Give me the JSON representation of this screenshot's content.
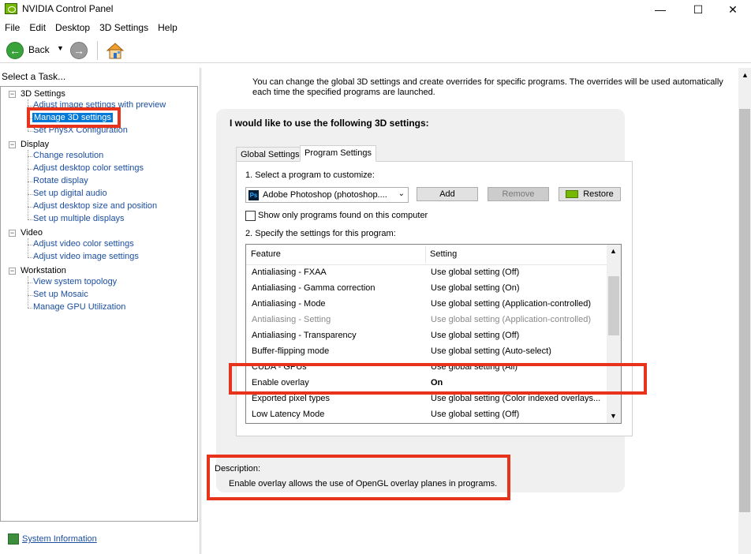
{
  "window": {
    "title": "NVIDIA Control Panel",
    "controls": {
      "minimize": "—",
      "maximize": "☐",
      "close": "✕"
    }
  },
  "menu": [
    "File",
    "Edit",
    "Desktop",
    "3D Settings",
    "Help"
  ],
  "toolbar": {
    "back_label": "Back",
    "back_dropdown": "▼",
    "back_arrow": "←",
    "forward_arrow": "→"
  },
  "sidebar": {
    "header": "Select a Task...",
    "groups": [
      {
        "label": "3D Settings",
        "toggle": "−",
        "items": [
          "Adjust image settings with preview",
          "Manage 3D settings",
          "Set PhysX Configuration"
        ]
      },
      {
        "label": "Display",
        "toggle": "−",
        "items": [
          "Change resolution",
          "Adjust desktop color settings",
          "Rotate display",
          "Set up digital audio",
          "Adjust desktop size and position",
          "Set up multiple displays"
        ]
      },
      {
        "label": "Video",
        "toggle": "−",
        "items": [
          "Adjust video color settings",
          "Adjust video image settings"
        ]
      },
      {
        "label": "Workstation",
        "toggle": "−",
        "items": [
          "View system topology",
          "Set up Mosaic",
          "Manage GPU Utilization"
        ]
      }
    ],
    "selected_item": "Manage 3D settings",
    "system_info": "System Information"
  },
  "content": {
    "intro": "You can change the global 3D settings and create overrides for specific programs. The overrides will be used automatically each time the specified programs are launched.",
    "heading": "I would like to use the following 3D settings:",
    "tabs": [
      {
        "label": "Global Settings",
        "active": false
      },
      {
        "label": "Program Settings",
        "active": true
      }
    ],
    "step1": "1. Select a program to customize:",
    "program_select": {
      "value": "Adobe Photoshop (photoshop....",
      "icon": "Ps",
      "chevron": "⌄"
    },
    "buttons": {
      "add": "Add",
      "remove": "Remove",
      "restore": "Restore"
    },
    "show_only_label": "Show only programs found on this computer",
    "step2": "2. Specify the settings for this program:",
    "table": {
      "columns": [
        "Feature",
        "Setting"
      ],
      "rows": [
        {
          "feature": "Antialiasing - FXAA",
          "setting": "Use global setting (Off)",
          "state": "normal"
        },
        {
          "feature": "Antialiasing - Gamma correction",
          "setting": "Use global setting (On)",
          "state": "normal"
        },
        {
          "feature": "Antialiasing - Mode",
          "setting": "Use global setting (Application-controlled)",
          "state": "normal"
        },
        {
          "feature": "Antialiasing - Setting",
          "setting": "Use global setting (Application-controlled)",
          "state": "disabled"
        },
        {
          "feature": "Antialiasing - Transparency",
          "setting": "Use global setting (Off)",
          "state": "normal"
        },
        {
          "feature": "Buffer-flipping mode",
          "setting": "Use global setting (Auto-select)",
          "state": "normal"
        },
        {
          "feature": "CUDA - GPUs",
          "setting": "Use global setting (All)",
          "state": "normal"
        },
        {
          "feature": "Enable overlay",
          "setting": "On",
          "state": "bold"
        },
        {
          "feature": "Exported pixel types",
          "setting": "Use global setting (Color indexed overlays...",
          "state": "normal"
        },
        {
          "feature": "Low Latency Mode",
          "setting": "Use global setting (Off)",
          "state": "normal"
        }
      ],
      "scroll_up": "▲",
      "scroll_down": "▼"
    },
    "description_title": "Description:",
    "description_text": "Enable overlay allows the use of OpenGL overlay planes in programs."
  },
  "colors": {
    "annotation": "#e8331c",
    "selection": "#0078d7",
    "link": "#1c4ea0",
    "nvidia_green": "#76b900"
  }
}
